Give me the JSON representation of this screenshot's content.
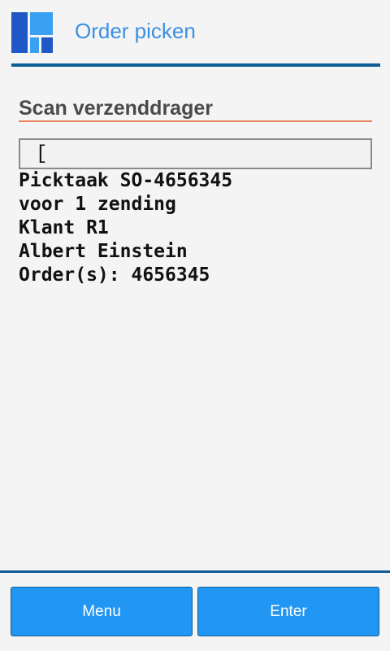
{
  "header": {
    "title": "Order picken",
    "logo_icon": "app-logo-icon",
    "colors": {
      "logo_dark": "#1f57c7",
      "logo_light": "#3aa0f2",
      "title": "#3d8fe0",
      "rule": "#0d5d97"
    }
  },
  "scan": {
    "title": "Scan verzenddrager",
    "input_value": "[",
    "underline_color": "#e8825a"
  },
  "info": {
    "lines": [
      "Picktaak SO-4656345",
      "voor 1 zending",
      "Klant R1",
      "Albert Einstein",
      "Order(s): 4656345"
    ]
  },
  "footer": {
    "buttons": {
      "menu": "Menu",
      "enter": "Enter"
    },
    "button_color": "#2196f3"
  }
}
